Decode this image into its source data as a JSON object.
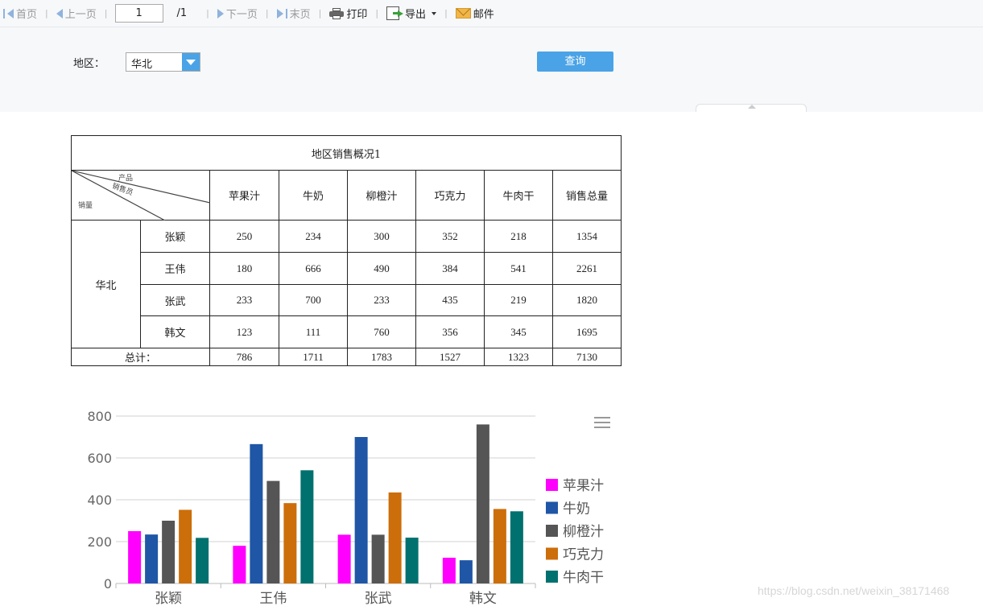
{
  "toolbar": {
    "first": "首页",
    "prev": "上一页",
    "page_value": "1",
    "total_pages": "/1",
    "next": "下一页",
    "last": "末页",
    "print": "打印",
    "export": "导出",
    "mail": "邮件"
  },
  "filter": {
    "region_label": "地区：",
    "region_value": "华北",
    "query_label": "查询"
  },
  "report": {
    "title": "地区销售概况1",
    "corner_labels": {
      "product": "产品",
      "salesperson": "销售员",
      "quantity": "销量"
    },
    "columns": [
      "苹果汁",
      "牛奶",
      "柳橙汁",
      "巧克力",
      "牛肉干",
      "销售总量"
    ],
    "region": "华北",
    "rows": [
      {
        "name": "张颖",
        "values": [
          "250",
          "234",
          "300",
          "352",
          "218",
          "1354"
        ]
      },
      {
        "name": "王伟",
        "values": [
          "180",
          "666",
          "490",
          "384",
          "541",
          "2261"
        ]
      },
      {
        "name": "张武",
        "values": [
          "233",
          "700",
          "233",
          "435",
          "219",
          "1820"
        ]
      },
      {
        "name": "韩文",
        "values": [
          "123",
          "111",
          "760",
          "356",
          "345",
          "1695"
        ]
      }
    ],
    "total_label": "总计：",
    "totals": [
      "786",
      "1711",
      "1783",
      "1527",
      "1323",
      "7130"
    ]
  },
  "chart_data": {
    "type": "bar",
    "categories": [
      "张颖",
      "王伟",
      "张武",
      "韩文"
    ],
    "series": [
      {
        "name": "苹果汁",
        "color": "#ff00ff",
        "values": [
          250,
          180,
          233,
          123
        ]
      },
      {
        "name": "牛奶",
        "color": "#1f56a6",
        "values": [
          234,
          666,
          700,
          111
        ]
      },
      {
        "name": "柳橙汁",
        "color": "#555555",
        "values": [
          300,
          490,
          233,
          760
        ]
      },
      {
        "name": "巧克力",
        "color": "#cc6e0a",
        "values": [
          352,
          384,
          435,
          356
        ]
      },
      {
        "name": "牛肉干",
        "color": "#00716e",
        "values": [
          218,
          541,
          219,
          345
        ]
      }
    ],
    "yticks": [
      "0",
      "200",
      "400",
      "600",
      "800"
    ],
    "ylim": [
      0,
      800
    ],
    "grid": true,
    "legend": "right"
  },
  "watermark": "https://blog.csdn.net/weixin_38171468"
}
